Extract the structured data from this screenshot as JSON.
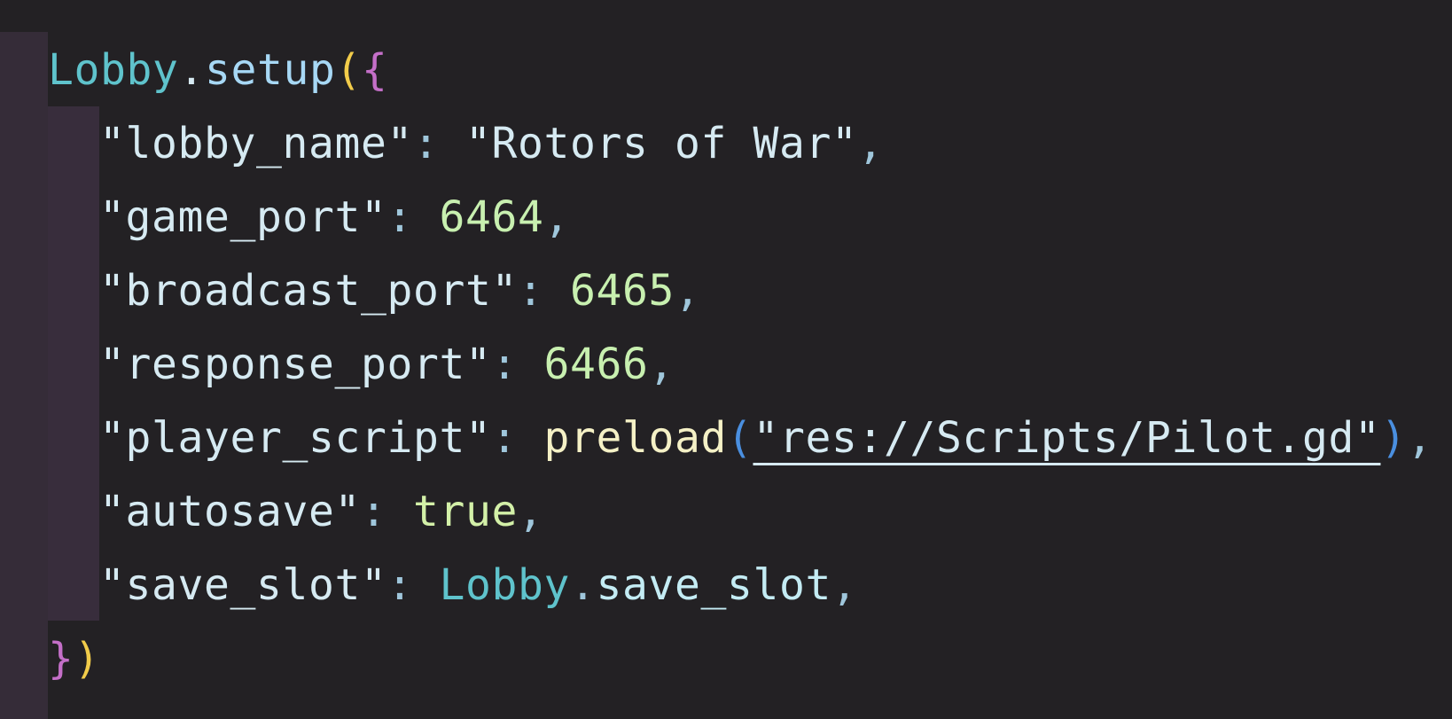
{
  "code": {
    "line1": {
      "class_name": "Lobby",
      "dot": ".",
      "method": "setup",
      "open_paren": "(",
      "open_brace": "{"
    },
    "entries": [
      {
        "key": "\"lobby_name\"",
        "colon": ": ",
        "value": "\"Rotors of War\"",
        "comma": ","
      },
      {
        "key": "\"game_port\"",
        "colon": ": ",
        "value": "6464",
        "comma": ","
      },
      {
        "key": "\"broadcast_port\"",
        "colon": ": ",
        "value": "6465",
        "comma": ","
      },
      {
        "key": "\"response_port\"",
        "colon": ": ",
        "value": "6466",
        "comma": ","
      },
      {
        "key": "\"player_script\"",
        "colon": ": ",
        "call": "preload",
        "open_paren": "(",
        "value": "\"res://Scripts/Pilot.gd\"",
        "close_paren": ")",
        "comma": ","
      },
      {
        "key": "\"autosave\"",
        "colon": ": ",
        "value": "true",
        "comma": ","
      },
      {
        "key": "\"save_slot\"",
        "colon": ": ",
        "class_name": "Lobby",
        "dot": ".",
        "value": "save_slot",
        "comma": ","
      }
    ],
    "last_line": {
      "close_brace": "}",
      "close_paren": ")"
    }
  },
  "colors": {
    "background": "#232124",
    "gutter": "#352c38",
    "class": "#5fc3cc",
    "brace": "#c46fc8",
    "paren": "#f2cc4a",
    "number": "#c8f0b0"
  }
}
